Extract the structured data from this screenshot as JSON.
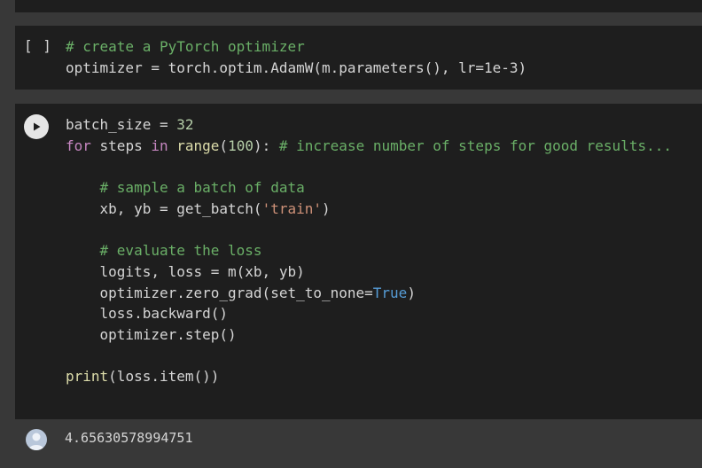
{
  "cells": [
    {
      "exec_label": "[ ]",
      "lines": [
        [
          {
            "t": "cmt",
            "v": "# create a PyTorch optimizer"
          }
        ],
        [
          {
            "t": "",
            "v": "optimizer = torch.optim.AdamW(m.parameters(), lr=1e-3)"
          }
        ]
      ]
    },
    {
      "lines": [
        [
          {
            "t": "",
            "v": "batch_size = "
          },
          {
            "t": "num",
            "v": "32"
          }
        ],
        [
          {
            "t": "kw",
            "v": "for"
          },
          {
            "t": "",
            "v": " steps "
          },
          {
            "t": "kw",
            "v": "in"
          },
          {
            "t": "",
            "v": " "
          },
          {
            "t": "bi",
            "v": "range"
          },
          {
            "t": "",
            "v": "("
          },
          {
            "t": "num",
            "v": "100"
          },
          {
            "t": "",
            "v": "): "
          },
          {
            "t": "cmt",
            "v": "# increase number of steps for good results..."
          }
        ],
        [
          {
            "t": "",
            "v": ""
          }
        ],
        [
          {
            "t": "",
            "v": "    "
          },
          {
            "t": "cmt",
            "v": "# sample a batch of data"
          }
        ],
        [
          {
            "t": "",
            "v": "    xb, yb = get_batch("
          },
          {
            "t": "str",
            "v": "'train'"
          },
          {
            "t": "",
            "v": ")"
          }
        ],
        [
          {
            "t": "",
            "v": ""
          }
        ],
        [
          {
            "t": "",
            "v": "    "
          },
          {
            "t": "cmt",
            "v": "# evaluate the loss"
          }
        ],
        [
          {
            "t": "",
            "v": "    logits, loss = m(xb, yb)"
          }
        ],
        [
          {
            "t": "",
            "v": "    optimizer.zero_grad(set_to_none="
          },
          {
            "t": "const",
            "v": "True"
          },
          {
            "t": "",
            "v": ")"
          }
        ],
        [
          {
            "t": "",
            "v": "    loss.backward()"
          }
        ],
        [
          {
            "t": "",
            "v": "    optimizer.step()"
          }
        ],
        [
          {
            "t": "",
            "v": ""
          }
        ],
        [
          {
            "t": "bi",
            "v": "print"
          },
          {
            "t": "",
            "v": "(loss.item())"
          }
        ]
      ]
    }
  ],
  "output": {
    "text": "4.65630578994751",
    "icon": "output-avatar-icon"
  },
  "colors": {
    "background": "#383838",
    "cell_bg": "#1e1e1e",
    "comment": "#6aaf67",
    "keyword": "#c586c0",
    "builtin": "#dcdcaa",
    "number": "#b5cea8",
    "string": "#ce9178",
    "constant": "#569cd6"
  }
}
